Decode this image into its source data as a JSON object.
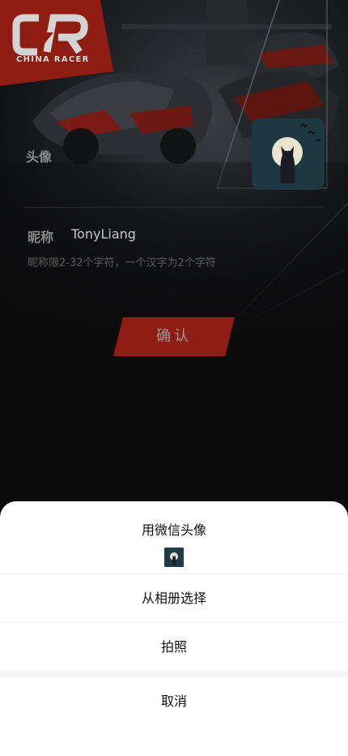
{
  "logo": {
    "mark": "CR",
    "text": "CHINA RACER",
    "color": "#8f1d14"
  },
  "form": {
    "avatar_label": "头像",
    "nickname_label": "昵称",
    "nickname_value": "TonyLiang",
    "nickname_hint": "昵称限2-32个字符，一个汉字为2个字符",
    "confirm_label": "确认",
    "accent": "#8f1d14"
  },
  "action_sheet": {
    "use_wechat_avatar": "用微信头像",
    "choose_from_album": "从相册选择",
    "take_photo": "拍照",
    "cancel": "取消"
  }
}
